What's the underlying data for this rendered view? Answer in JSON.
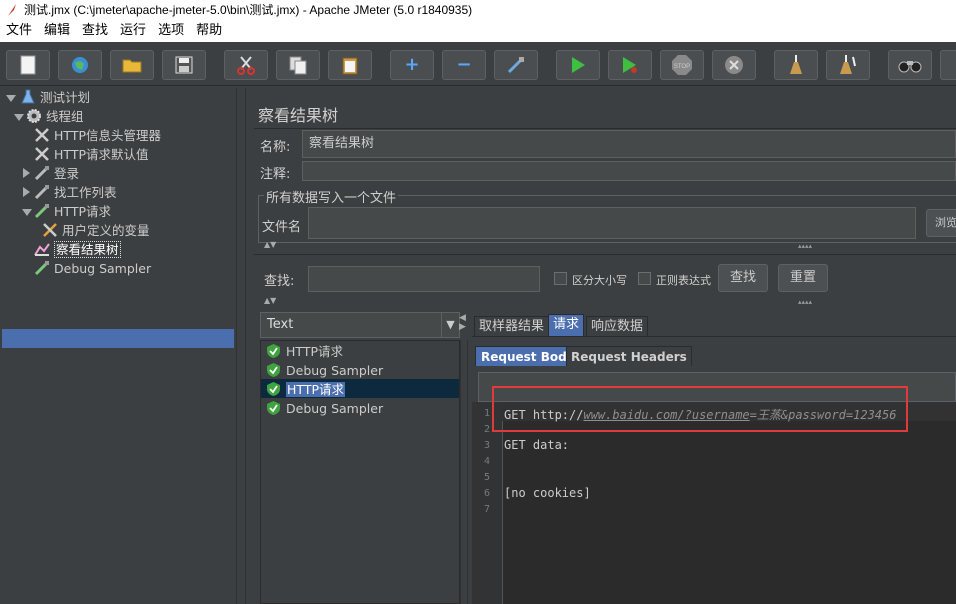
{
  "window": {
    "title": "测试.jmx (C:\\jmeter\\apache-jmeter-5.0\\bin\\测试.jmx) - Apache JMeter (5.0 r1840935)"
  },
  "menu": [
    "文件",
    "编辑",
    "查找",
    "运行",
    "选项",
    "帮助"
  ],
  "toolbar": {
    "icons": [
      "new-icon",
      "templates-icon",
      "open-icon",
      "save-icon",
      "cut-icon",
      "copy-icon",
      "paste-icon",
      "expand-icon",
      "collapse-icon",
      "toggle-icon",
      "start-icon",
      "start-no-pause-icon",
      "stop-icon",
      "shutdown-icon",
      "clear-icon",
      "clear-all-icon",
      "search-icon",
      "reset-search-icon"
    ],
    "stop_label": "STOP"
  },
  "tree": {
    "items": [
      {
        "label": "测试计划"
      },
      {
        "label": "线程组"
      },
      {
        "label": "HTTP信息头管理器"
      },
      {
        "label": "HTTP请求默认值"
      },
      {
        "label": "登录"
      },
      {
        "label": "找工作列表"
      },
      {
        "label": "HTTP请求"
      },
      {
        "label": "用户定义的变量"
      },
      {
        "label": "察看结果树"
      },
      {
        "label": "Debug Sampler"
      }
    ]
  },
  "panel": {
    "title": "察看结果树",
    "name_label": "名称:",
    "name_value": "察看结果树",
    "comment_label": "注释:",
    "file_group_label": "所有数据写入一个文件",
    "filename_label": "文件名",
    "browse_label": "浏览",
    "search_label": "查找:",
    "case_label": "区分大小写",
    "regex_label": "正则表达式",
    "find_button": "查找",
    "reset_button": "重置"
  },
  "results": {
    "renderer": "Text",
    "items": [
      "HTTP请求",
      "Debug Sampler",
      "HTTP请求",
      "Debug Sampler"
    ]
  },
  "tabs": {
    "main": [
      "取样器结果",
      "请求",
      "响应数据"
    ],
    "active_main": "请求",
    "sub": [
      "Request Body",
      "Request Headers"
    ],
    "active_sub": "Request Body"
  },
  "request": {
    "line1_prefix": "GET http://",
    "line1_url": "www.baidu.com/?username",
    "line1_eq": "=王蒸&password=123456",
    "line3": "GET data:",
    "line6": "[no cookies]",
    "line_numbers": [
      "1",
      "2",
      "3",
      "4",
      "5",
      "6",
      "7"
    ]
  },
  "colors": {
    "accent": "#4b6eaf",
    "highlight_box": "#e03a3a",
    "background": "#3c3f41"
  }
}
